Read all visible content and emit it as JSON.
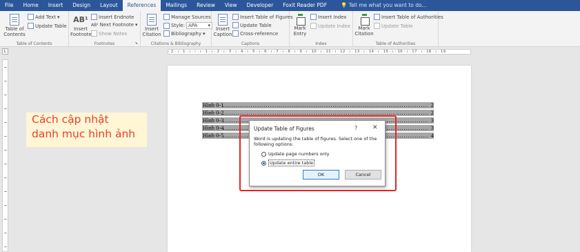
{
  "menu": {
    "tabs": [
      "File",
      "Home",
      "Insert",
      "Design",
      "Layout",
      "References",
      "Mailings",
      "Review",
      "View",
      "Developer",
      "Foxit Reader PDF"
    ],
    "active_tab": "References",
    "tell_me": "Tell me what you want to do..."
  },
  "ribbon": {
    "toc": {
      "table_of_contents": "Table of\nContents",
      "add_text": "Add Text",
      "update_table": "Update Table",
      "label": "Table of Contents"
    },
    "footnotes": {
      "insert_footnote": "Insert\nFootnote",
      "insert_endnote": "Insert Endnote",
      "next_footnote": "Next Footnote",
      "show_notes": "Show Notes",
      "label": "Footnotes"
    },
    "citations": {
      "insert_citation": "Insert\nCitation",
      "manage_sources": "Manage Sources",
      "style_label": "Style:",
      "style_value": "APA",
      "bibliography": "Bibliography",
      "label": "Citations & Bibliography"
    },
    "captions": {
      "insert_caption": "Insert\nCaption",
      "insert_table_of_figures": "Insert Table of Figures",
      "update_table": "Update Table",
      "cross_reference": "Cross-reference",
      "label": "Captions"
    },
    "index": {
      "mark_entry": "Mark\nEntry",
      "insert_index": "Insert Index",
      "update_index": "Update Index",
      "label": "Index"
    },
    "authorities": {
      "mark_citation": "Mark\nCitation",
      "insert_table_of_authorities": "Insert Table of Authorities",
      "update_table": "Update Table",
      "label": "Table of Authorities"
    }
  },
  "ruler": {
    "horizontal": "· 2 · ı · 1 · ı · ⁞ · ı · 1 · ı · 2 · ı · 3 · ı · 4 · ı · 5 · ı · 6 · ı · 7 · ı · 8 · ı · 9 · ı · 10 · ı · 11 · ı · 12 · ı · 13 · ı · 14 · ı · 15 · ı · 16 · ı · 17 · ı · 18 · ı · 19",
    "corner": "L"
  },
  "document": {
    "toc_entries": [
      {
        "label": "Hình 0-1",
        "page": "2"
      },
      {
        "label": "Hình 0-2",
        "page": "2"
      },
      {
        "label": "Hình 0-3",
        "page": "3"
      },
      {
        "label": "Hình 0-4",
        "page": "3"
      },
      {
        "label": "Hình 0-5",
        "page": "4"
      }
    ]
  },
  "callout": {
    "line1": "Cách cập nhật",
    "line2": "danh mục hình ảnh"
  },
  "dialog": {
    "title": "Update Table of Figures",
    "help": "?",
    "close": "✕",
    "message": "Word is updating the table of figures.  Select one of the following options:",
    "option_page_numbers": "Update page numbers only",
    "option_entire_table": "Update entire table",
    "selected_option": "Update entire table",
    "ok": "OK",
    "cancel": "Cancel"
  }
}
